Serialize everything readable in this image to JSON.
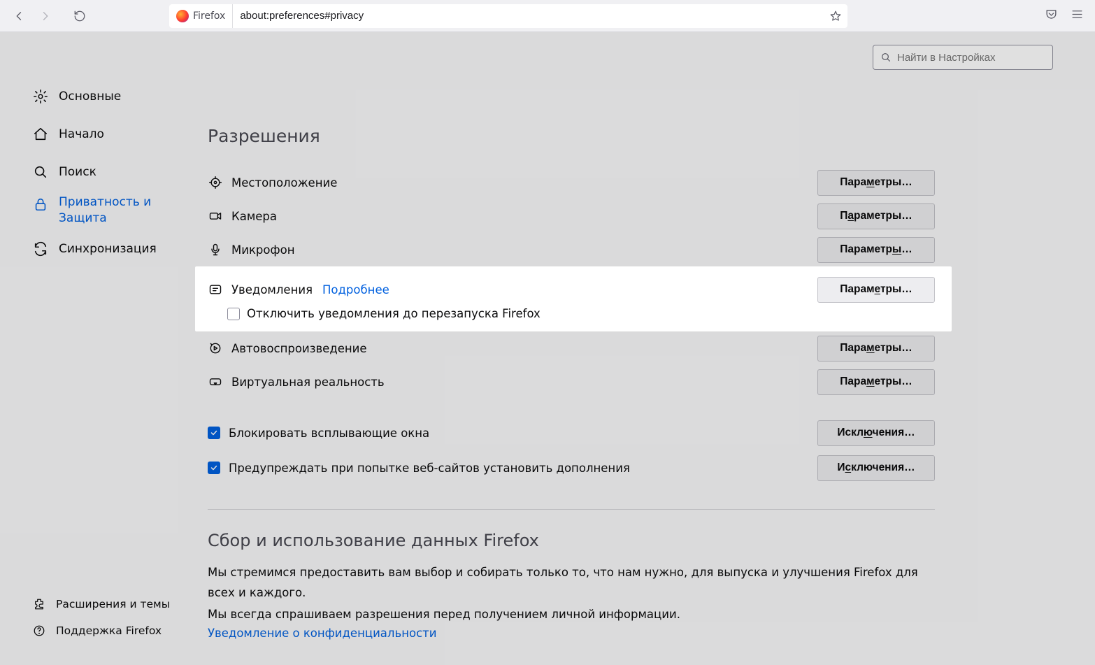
{
  "chrome": {
    "identity_label": "Firefox",
    "url": "about:preferences#privacy"
  },
  "search": {
    "placeholder": "Найти в Настройках"
  },
  "sidebar": {
    "items": [
      {
        "label": "Основные"
      },
      {
        "label": "Начало"
      },
      {
        "label": "Поиск"
      },
      {
        "label": "Приватность и Защита"
      },
      {
        "label": "Синхронизация"
      }
    ],
    "bottom": [
      {
        "label": "Расширения и темы"
      },
      {
        "label": "Поддержка Firefox"
      }
    ]
  },
  "sections": {
    "permissions_title": "Разрешения",
    "perms": [
      {
        "label": "Местоположение",
        "btn_pre": "Пара",
        "btn_ak": "м",
        "btn_post": "етры…"
      },
      {
        "label": "Камера",
        "btn_pre": "П",
        "btn_ak": "а",
        "btn_post": "раметры…"
      },
      {
        "label": "Микрофон",
        "btn_pre": "Параметр",
        "btn_ak": "ы",
        "btn_post": "…"
      },
      {
        "label": "Уведомления",
        "more": "Подробнее",
        "btn_pre": "Парам",
        "btn_ak": "е",
        "btn_post": "тры…",
        "sub_pre": "Откл",
        "sub_ak": "ю",
        "sub_post": "чить уведомления до перезапуска Firefox"
      },
      {
        "label": "Автовоспроизведение",
        "btn_pre": "Пара",
        "btn_ak": "м",
        "btn_post": "етры…"
      },
      {
        "label": "Виртуальная реальность",
        "btn_pre": "Пара",
        "btn_ak": "м",
        "btn_post": "етры…"
      }
    ],
    "checks": [
      {
        "pre": "Бл",
        "ak": "о",
        "post": "кировать всплывающие окна",
        "btn_pre": "Искл",
        "btn_ak": "ю",
        "btn_post": "чения…"
      },
      {
        "pre": "Пр",
        "ak": "е",
        "post": "дупреждать при попытке веб-сайтов установить дополнения",
        "btn_pre": "И",
        "btn_ak": "с",
        "btn_post": "ключения…"
      }
    ],
    "data_title": "Сбор и использование данных Firefox",
    "data_body1": "Мы стремимся предоставить вам выбор и собирать только то, что нам нужно, для выпуска и улучшения Firefox для всех и каждого.",
    "data_body2": "Мы всегда спрашиваем разрешения перед получением личной информации.",
    "privacy_notice": "Уведомление о конфиденциальности"
  }
}
